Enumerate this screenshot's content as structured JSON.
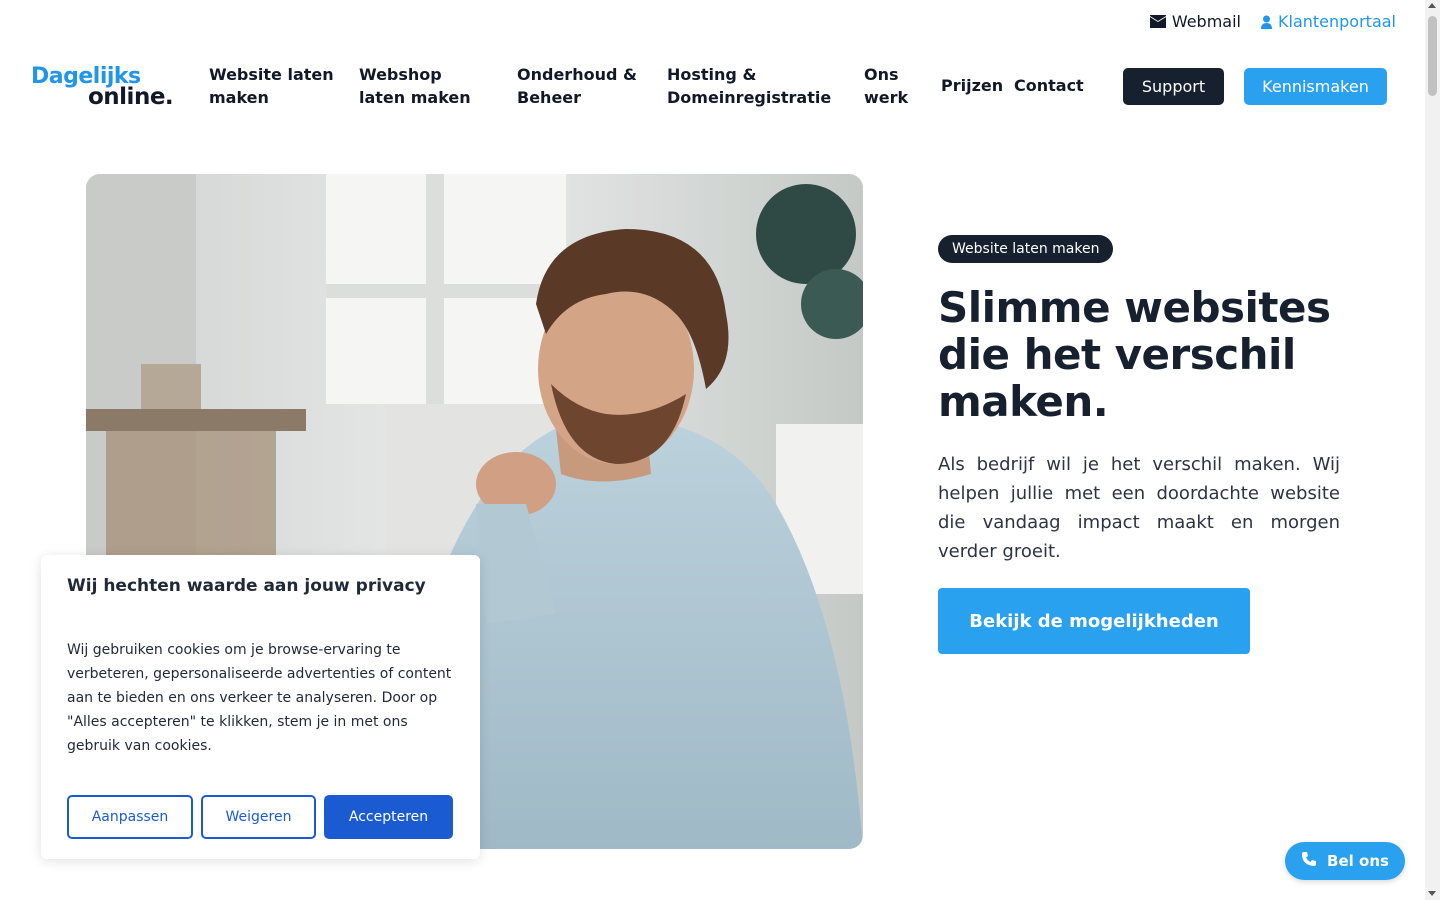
{
  "topbar": {
    "webmail_label": "Webmail",
    "portal_label": "Klantenportaal",
    "webmail_icon": "envelope-icon",
    "portal_icon": "user-icon"
  },
  "logo": {
    "line1": "Dagelijks",
    "line2": "online."
  },
  "nav": {
    "items": [
      {
        "label": "Website laten maken"
      },
      {
        "label": "Webshop laten maken"
      },
      {
        "label": "Onderhoud & Beheer"
      },
      {
        "label": "Hosting & Domeinregistratie"
      },
      {
        "label": "Ons werk"
      },
      {
        "label": "Prijzen"
      },
      {
        "label": "Contact"
      }
    ],
    "support_label": "Support",
    "kennismaken_label": "Kennismaken"
  },
  "hero": {
    "badge": "Website laten maken",
    "title": "Slimme websites die het verschil maken.",
    "body": "Als bedrijf wil je het verschil maken. Wij helpen jullie met een doordachte website die vandaag impact maakt en morgen verder groeit.",
    "cta_label": "Bekijk de mogelijkheden"
  },
  "cookie": {
    "title": "Wij hechten waarde aan jouw privacy",
    "body": "Wij gebruiken cookies om je browse-ervaring te verbeteren, gepersonaliseerde advertenties of content aan te bieden en ons verkeer te analyseren. Door op \"Alles accepteren\" te klikken, stem je in met ons gebruik van cookies.",
    "customize_label": "Aanpassen",
    "reject_label": "Weigeren",
    "accept_label": "Accepteren"
  },
  "call": {
    "label": "Bel ons",
    "icon": "phone-icon"
  },
  "colors": {
    "brand_blue": "#2aa1ef",
    "dark_navy": "#16202f",
    "cookie_blue": "#1b5bd1"
  }
}
